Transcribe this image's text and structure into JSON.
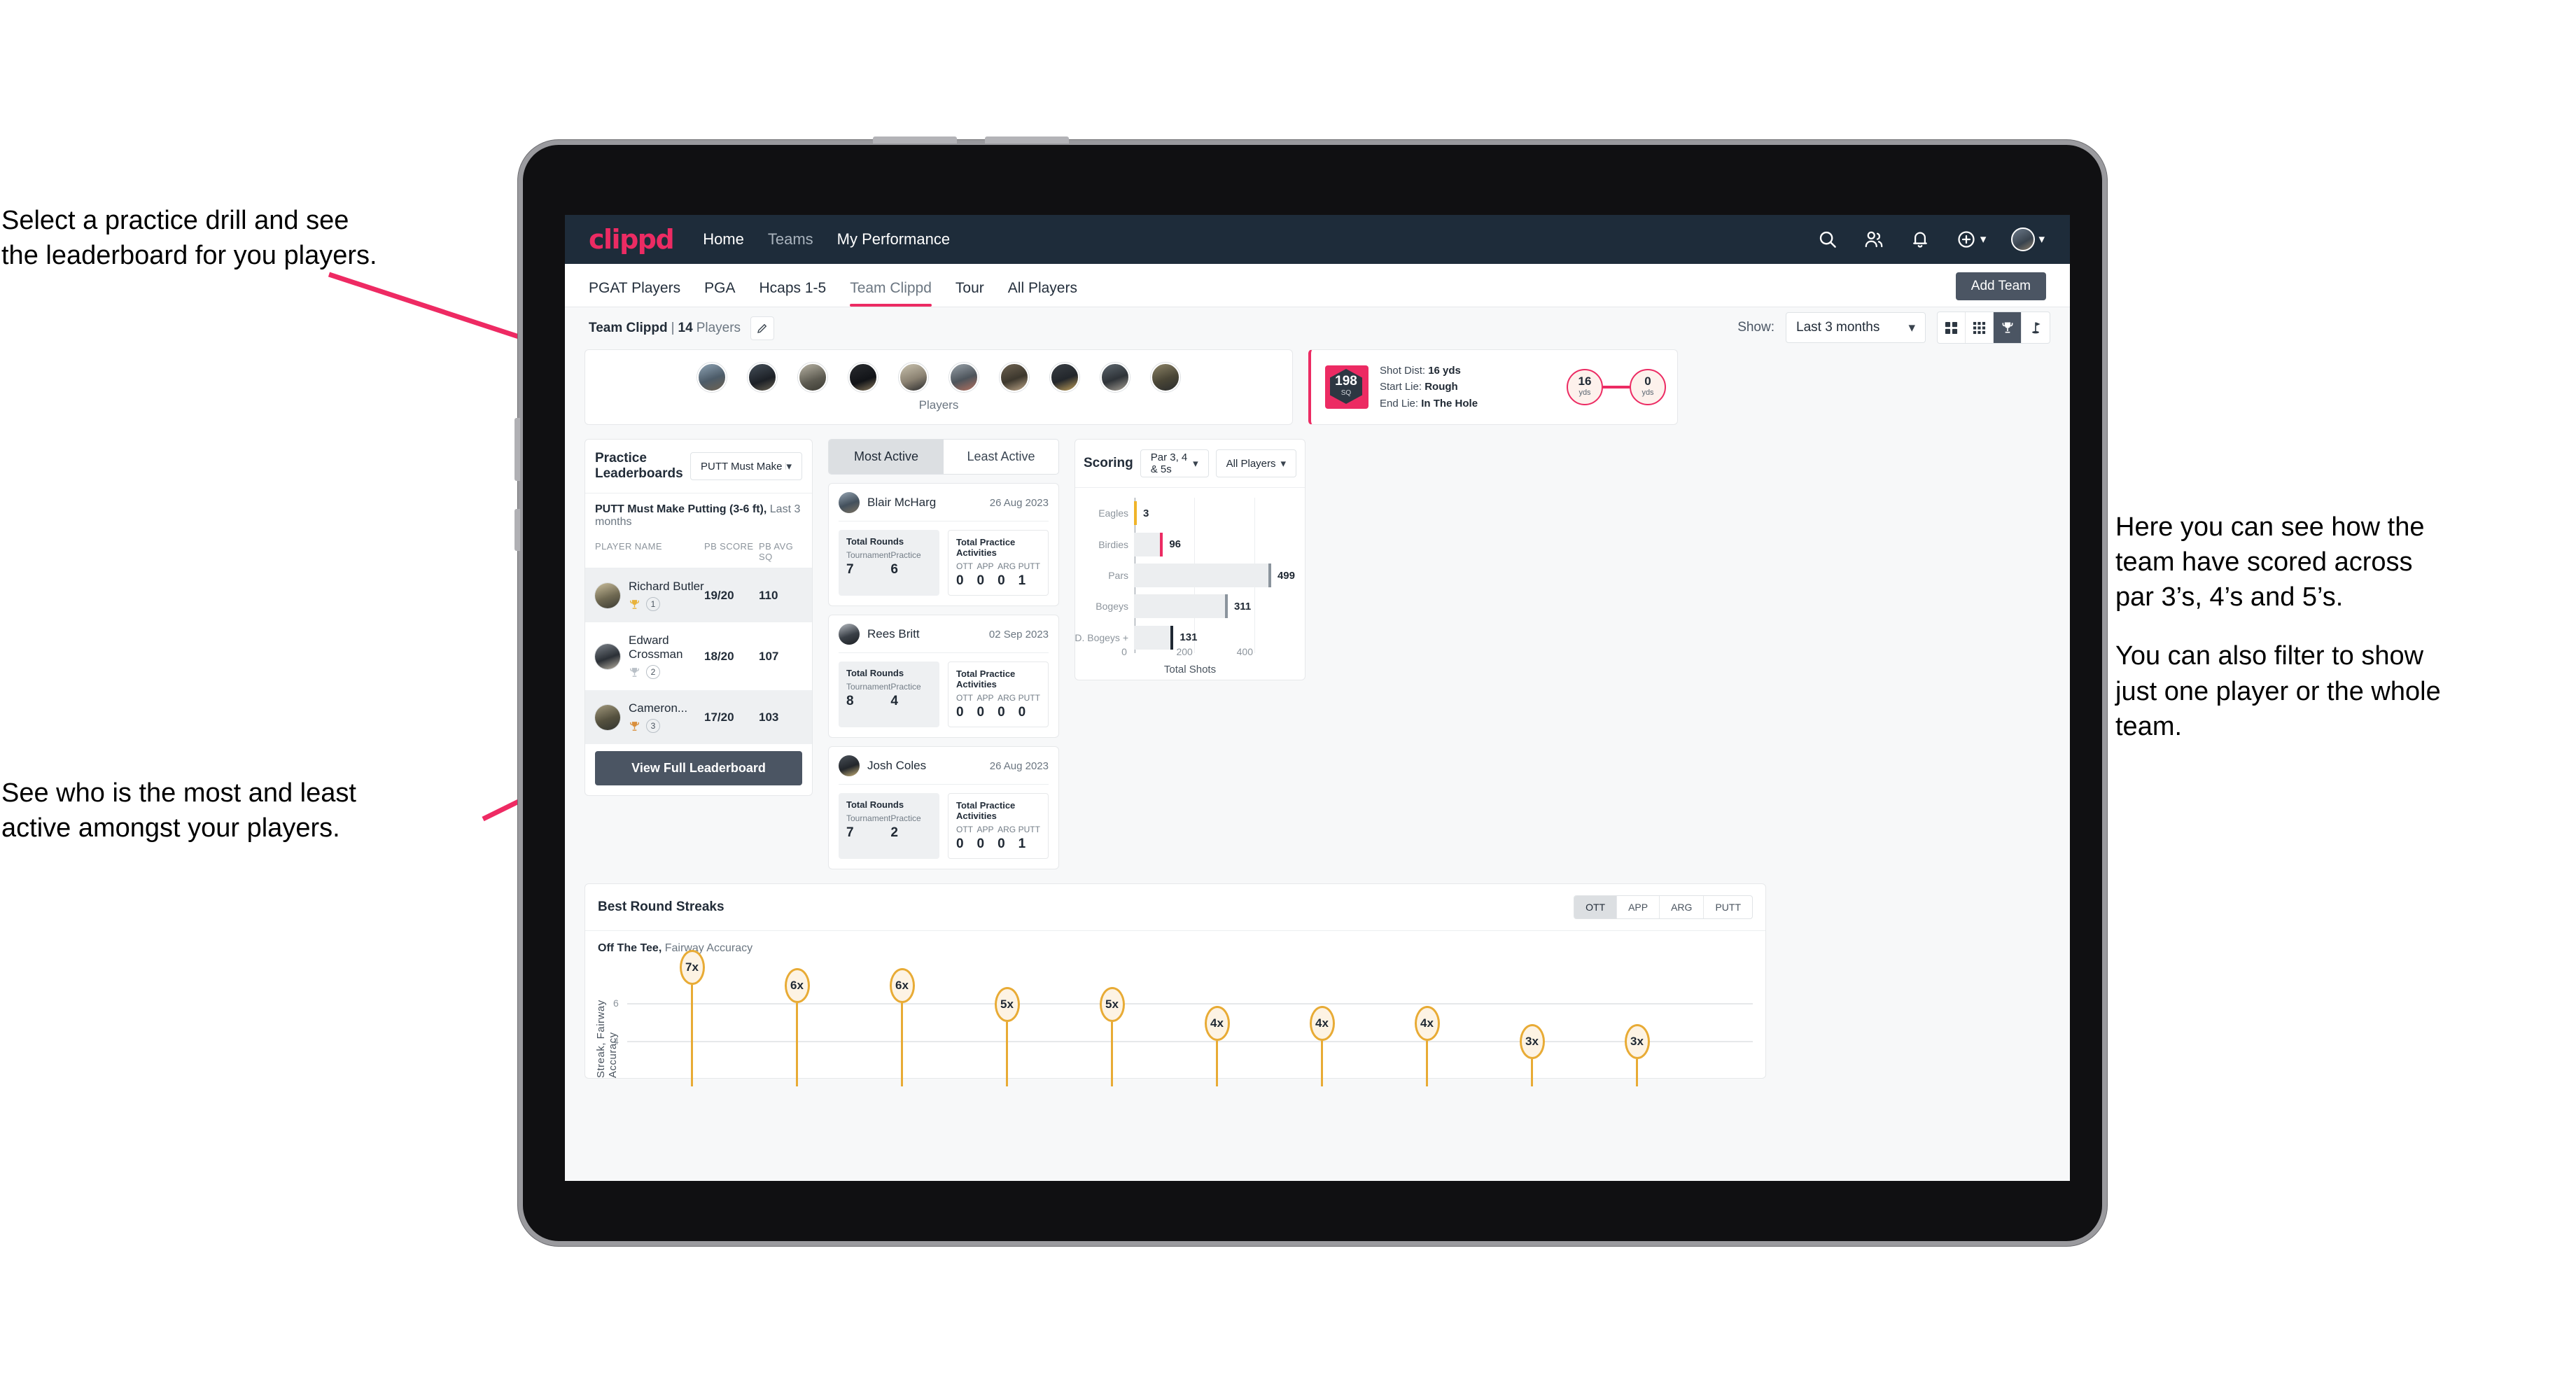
{
  "annotations": {
    "top_left": [
      "Select a practice drill and see",
      "the leaderboard for you players."
    ],
    "bottom_left": [
      "See who is the most and least",
      "active amongst your players."
    ],
    "right_1": [
      "Here you can see how the",
      "team have scored across",
      "par 3’s, 4’s and 5’s."
    ],
    "right_2": [
      "You can also filter to show",
      "just one player or the whole",
      "team."
    ]
  },
  "navbar": {
    "brand": "clippd",
    "links": [
      {
        "label": "Home",
        "active": true
      },
      {
        "label": "Teams",
        "active": false
      },
      {
        "label": "My Performance",
        "active": true
      }
    ],
    "icons": [
      "search-icon",
      "people-icon",
      "bell-icon",
      "plus-circle-icon",
      "avatar"
    ],
    "colors": {
      "bg": "#1e2c3a",
      "brand": "#ec2b63"
    }
  },
  "tabs": {
    "items": [
      "PGAT Players",
      "PGA",
      "Hcaps 1-5",
      "Team Clippd",
      "Tour",
      "All Players"
    ],
    "active": "Team Clippd",
    "add_team_label": "Add Team"
  },
  "team_line": {
    "name": "Team Clippd",
    "separator": "|",
    "count": "14",
    "count_label": "Players"
  },
  "toolbar": {
    "show_label": "Show:",
    "period_value": "Last 3 months",
    "view_icons": [
      "grid-large-icon",
      "grid-small-icon",
      "trophy-icon",
      "flag-icon"
    ],
    "active_view": "trophy-icon"
  },
  "players_strip": {
    "label": "Players",
    "count": 10
  },
  "shot_card": {
    "badge_value": "198",
    "badge_unit": "SQ",
    "lines": [
      {
        "key": "Shot Dist:",
        "value": "16 yds"
      },
      {
        "key": "Start Lie:",
        "value": "Rough"
      },
      {
        "key": "End Lie:",
        "value": "In The Hole"
      }
    ],
    "start_bubble": {
      "value": "16",
      "unit": "yds"
    },
    "end_bubble": {
      "value": "0",
      "unit": "yds"
    }
  },
  "leaderboard": {
    "title": "Practice Leaderboards",
    "drill_select": "PUTT Must Make Putting ...",
    "subtitle_bold": "PUTT Must Make Putting (3-6 ft),",
    "subtitle_light": "Last 3 months",
    "columns": [
      "PLAYER NAME",
      "PB SCORE",
      "PB AVG SQ"
    ],
    "rows": [
      {
        "name": "Richard Butler",
        "rank": "1",
        "score": "19/20",
        "avg": "110",
        "trophy": "gold"
      },
      {
        "name": "Edward Crossman",
        "rank": "2",
        "score": "18/20",
        "avg": "107",
        "trophy": "silver"
      },
      {
        "name": "Cameron...",
        "rank": "3",
        "score": "17/20",
        "avg": "103",
        "trophy": "bronze"
      }
    ],
    "button_label": "View Full Leaderboard"
  },
  "activity": {
    "tabs": [
      "Most Active",
      "Least Active"
    ],
    "active_tab": "Most Active",
    "rounds_title": "Total Rounds",
    "rounds_keys": [
      "Tournament",
      "Practice"
    ],
    "practice_title": "Total Practice Activities",
    "practice_keys": [
      "OTT",
      "APP",
      "ARG",
      "PUTT"
    ],
    "cards": [
      {
        "name": "Blair McHarg",
        "date": "26 Aug 2023",
        "tournament": "7",
        "practice": "6",
        "ott": "0",
        "app": "0",
        "arg": "0",
        "putt": "1"
      },
      {
        "name": "Rees Britt",
        "date": "02 Sep 2023",
        "tournament": "8",
        "practice": "4",
        "ott": "0",
        "app": "0",
        "arg": "0",
        "putt": "0"
      },
      {
        "name": "Josh Coles",
        "date": "26 Aug 2023",
        "tournament": "7",
        "practice": "2",
        "ott": "0",
        "app": "0",
        "arg": "0",
        "putt": "1"
      }
    ]
  },
  "scoring": {
    "title": "Scoring",
    "par_select": "Par 3, 4 & 5s",
    "players_select": "All Players"
  },
  "streaks": {
    "title": "Best Round Streaks",
    "tabs": [
      "OTT",
      "APP",
      "ARG",
      "PUTT"
    ],
    "active_tab": "OTT",
    "subtitle_bold": "Off The Tee,",
    "subtitle_light": "Fairway Accuracy"
  },
  "chart_data": [
    {
      "type": "bar",
      "orientation": "horizontal",
      "title": "Scoring",
      "categories": [
        "Eagles",
        "Birdies",
        "Pars",
        "Bogeys",
        "D. Bogeys +"
      ],
      "values": [
        3,
        96,
        499,
        311,
        131
      ],
      "cap_colors": [
        "#f0b429",
        "#ec2b63",
        "#8b949d",
        "#8b949d",
        "#1f2833"
      ],
      "xlabel": "Total Shots",
      "ylabel": "",
      "xlim": [
        0,
        520
      ],
      "xticks": [
        0,
        200,
        400
      ],
      "grid": true,
      "legend": "none"
    },
    {
      "type": "scatter",
      "title": "Best Round Streaks",
      "subtitle": "Off The Tee, Fairway Accuracy",
      "ylabel": "Streak, Fairway Accuracy",
      "xlabel": "",
      "yticks": [
        4,
        6
      ],
      "ylim": [
        2,
        8
      ],
      "grid": true,
      "legend": "none",
      "points": [
        {
          "x": 1,
          "label": "7x",
          "value": 7
        },
        {
          "x": 2,
          "label": "6x",
          "value": 6
        },
        {
          "x": 3,
          "label": "6x",
          "value": 6
        },
        {
          "x": 4,
          "label": "5x",
          "value": 5
        },
        {
          "x": 5,
          "label": "5x",
          "value": 5
        },
        {
          "x": 6,
          "label": "4x",
          "value": 4
        },
        {
          "x": 7,
          "label": "4x",
          "value": 4
        },
        {
          "x": 8,
          "label": "4x",
          "value": 4
        },
        {
          "x": 9,
          "label": "3x",
          "value": 3
        },
        {
          "x": 10,
          "label": "3x",
          "value": 3
        }
      ]
    }
  ]
}
